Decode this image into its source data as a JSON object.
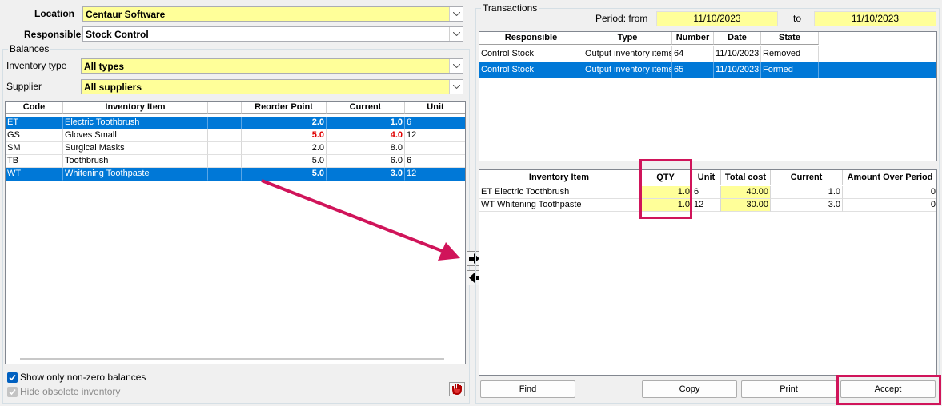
{
  "header": {
    "location_label": "Location",
    "location_value": "Centaur Software",
    "responsible_label": "Responsible",
    "responsible_value": "Stock  Control"
  },
  "balances": {
    "group_label": "Balances",
    "inventory_type_label": "Inventory type",
    "inventory_type_value": "All types",
    "supplier_label": "Supplier",
    "supplier_value": "All suppliers",
    "columns": [
      "Code",
      "Inventory Item",
      "",
      "Reorder Point",
      "Current",
      "Unit"
    ],
    "rows": [
      {
        "code": "ET",
        "item": "Electric Toothbrush",
        "reorder": "2.0",
        "current": "1.0",
        "unit": "6",
        "selected": true
      },
      {
        "code": "GS",
        "item": "Gloves Small",
        "reorder": "5.0",
        "current": "4.0",
        "unit": "12",
        "selected": false,
        "warn": true
      },
      {
        "code": "SM",
        "item": "Surgical Masks",
        "reorder": "2.0",
        "current": "8.0",
        "unit": "",
        "selected": false
      },
      {
        "code": "TB",
        "item": "Toothbrush",
        "reorder": "5.0",
        "current": "6.0",
        "unit": "6",
        "selected": false
      },
      {
        "code": "WT",
        "item": "Whitening Toothpaste",
        "reorder": "5.0",
        "current": "3.0",
        "unit": "12",
        "selected": true
      }
    ],
    "show_nonzero_label": "Show only non-zero balances",
    "show_nonzero_checked": true,
    "hide_obsolete_label": "Hide obsolete inventory",
    "hide_obsolete_checked": true
  },
  "transactions": {
    "group_label": "Transactions",
    "period_from_label": "Period: from",
    "period_from": "11/10/2023",
    "period_to_label": "to",
    "period_to": "11/10/2023",
    "columns": [
      "Responsible",
      "Type",
      "Number",
      "Date",
      "State"
    ],
    "rows": [
      {
        "responsible": "Control  Stock",
        "type": "Output inventory items",
        "number": "64",
        "date": "11/10/2023",
        "state": "Removed",
        "selected": false
      },
      {
        "responsible": "Control  Stock",
        "type": "Output inventory items",
        "number": "65",
        "date": "11/10/2023",
        "state": "Formed",
        "selected": true
      }
    ]
  },
  "items": {
    "columns": [
      "Inventory Item",
      "QTY",
      "Unit",
      "Total cost",
      "Current",
      "Amount Over Period"
    ],
    "rows": [
      {
        "item": "ET Electric Toothbrush",
        "qty": "1.0",
        "unit": "6",
        "total": "40.00",
        "current": "1.0",
        "amount": "0"
      },
      {
        "item": "WT Whitening Toothpaste",
        "qty": "1.0",
        "unit": "12",
        "total": "30.00",
        "current": "3.0",
        "amount": "0"
      }
    ]
  },
  "buttons": {
    "find": "Find",
    "copy": "Copy",
    "print": "Print",
    "accept": "Accept"
  },
  "colors": {
    "highlight": "#d0145a",
    "selection": "#0078d7",
    "field_yellow": "#ffff99"
  }
}
